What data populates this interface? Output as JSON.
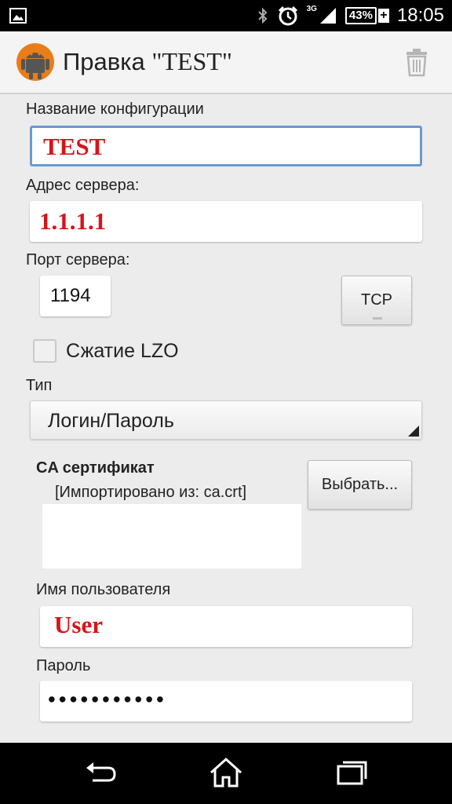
{
  "status_bar": {
    "time": "18:05",
    "battery": "43%",
    "network": "3G",
    "icons": [
      "image-icon",
      "bluetooth-icon",
      "alarm-icon",
      "signal-icon",
      "battery-icon"
    ]
  },
  "action_bar": {
    "title_prefix": "Правка ",
    "title_name": "\"TEST\"",
    "icons": [
      "app-icon",
      "trash-icon"
    ]
  },
  "form": {
    "config_name_label": "Название конфигурации",
    "config_name_value": "TEST",
    "server_address_label": "Адрес сервера:",
    "server_address_value": "1.1.1.1",
    "server_port_label": "Порт сервера:",
    "server_port_value": "1194",
    "protocol_button": "TCP",
    "lzo_label": "Сжатие LZO",
    "lzo_checked": false,
    "type_label": "Тип",
    "type_value": "Логин/Пароль",
    "ca_label": "CA сертификат",
    "ca_imported": "[Импортировано из: ca.crt]",
    "choose_button": "Выбрать...",
    "username_label": "Имя пользователя",
    "username_value": "User",
    "password_label": "Пароль",
    "password_value": "•••••••••••"
  },
  "nav_bar": {
    "icons": [
      "back-icon",
      "home-icon",
      "recent-apps-icon"
    ]
  },
  "colors": {
    "accent_focus": "#6a9ad0",
    "value_red": "#d6141a"
  }
}
